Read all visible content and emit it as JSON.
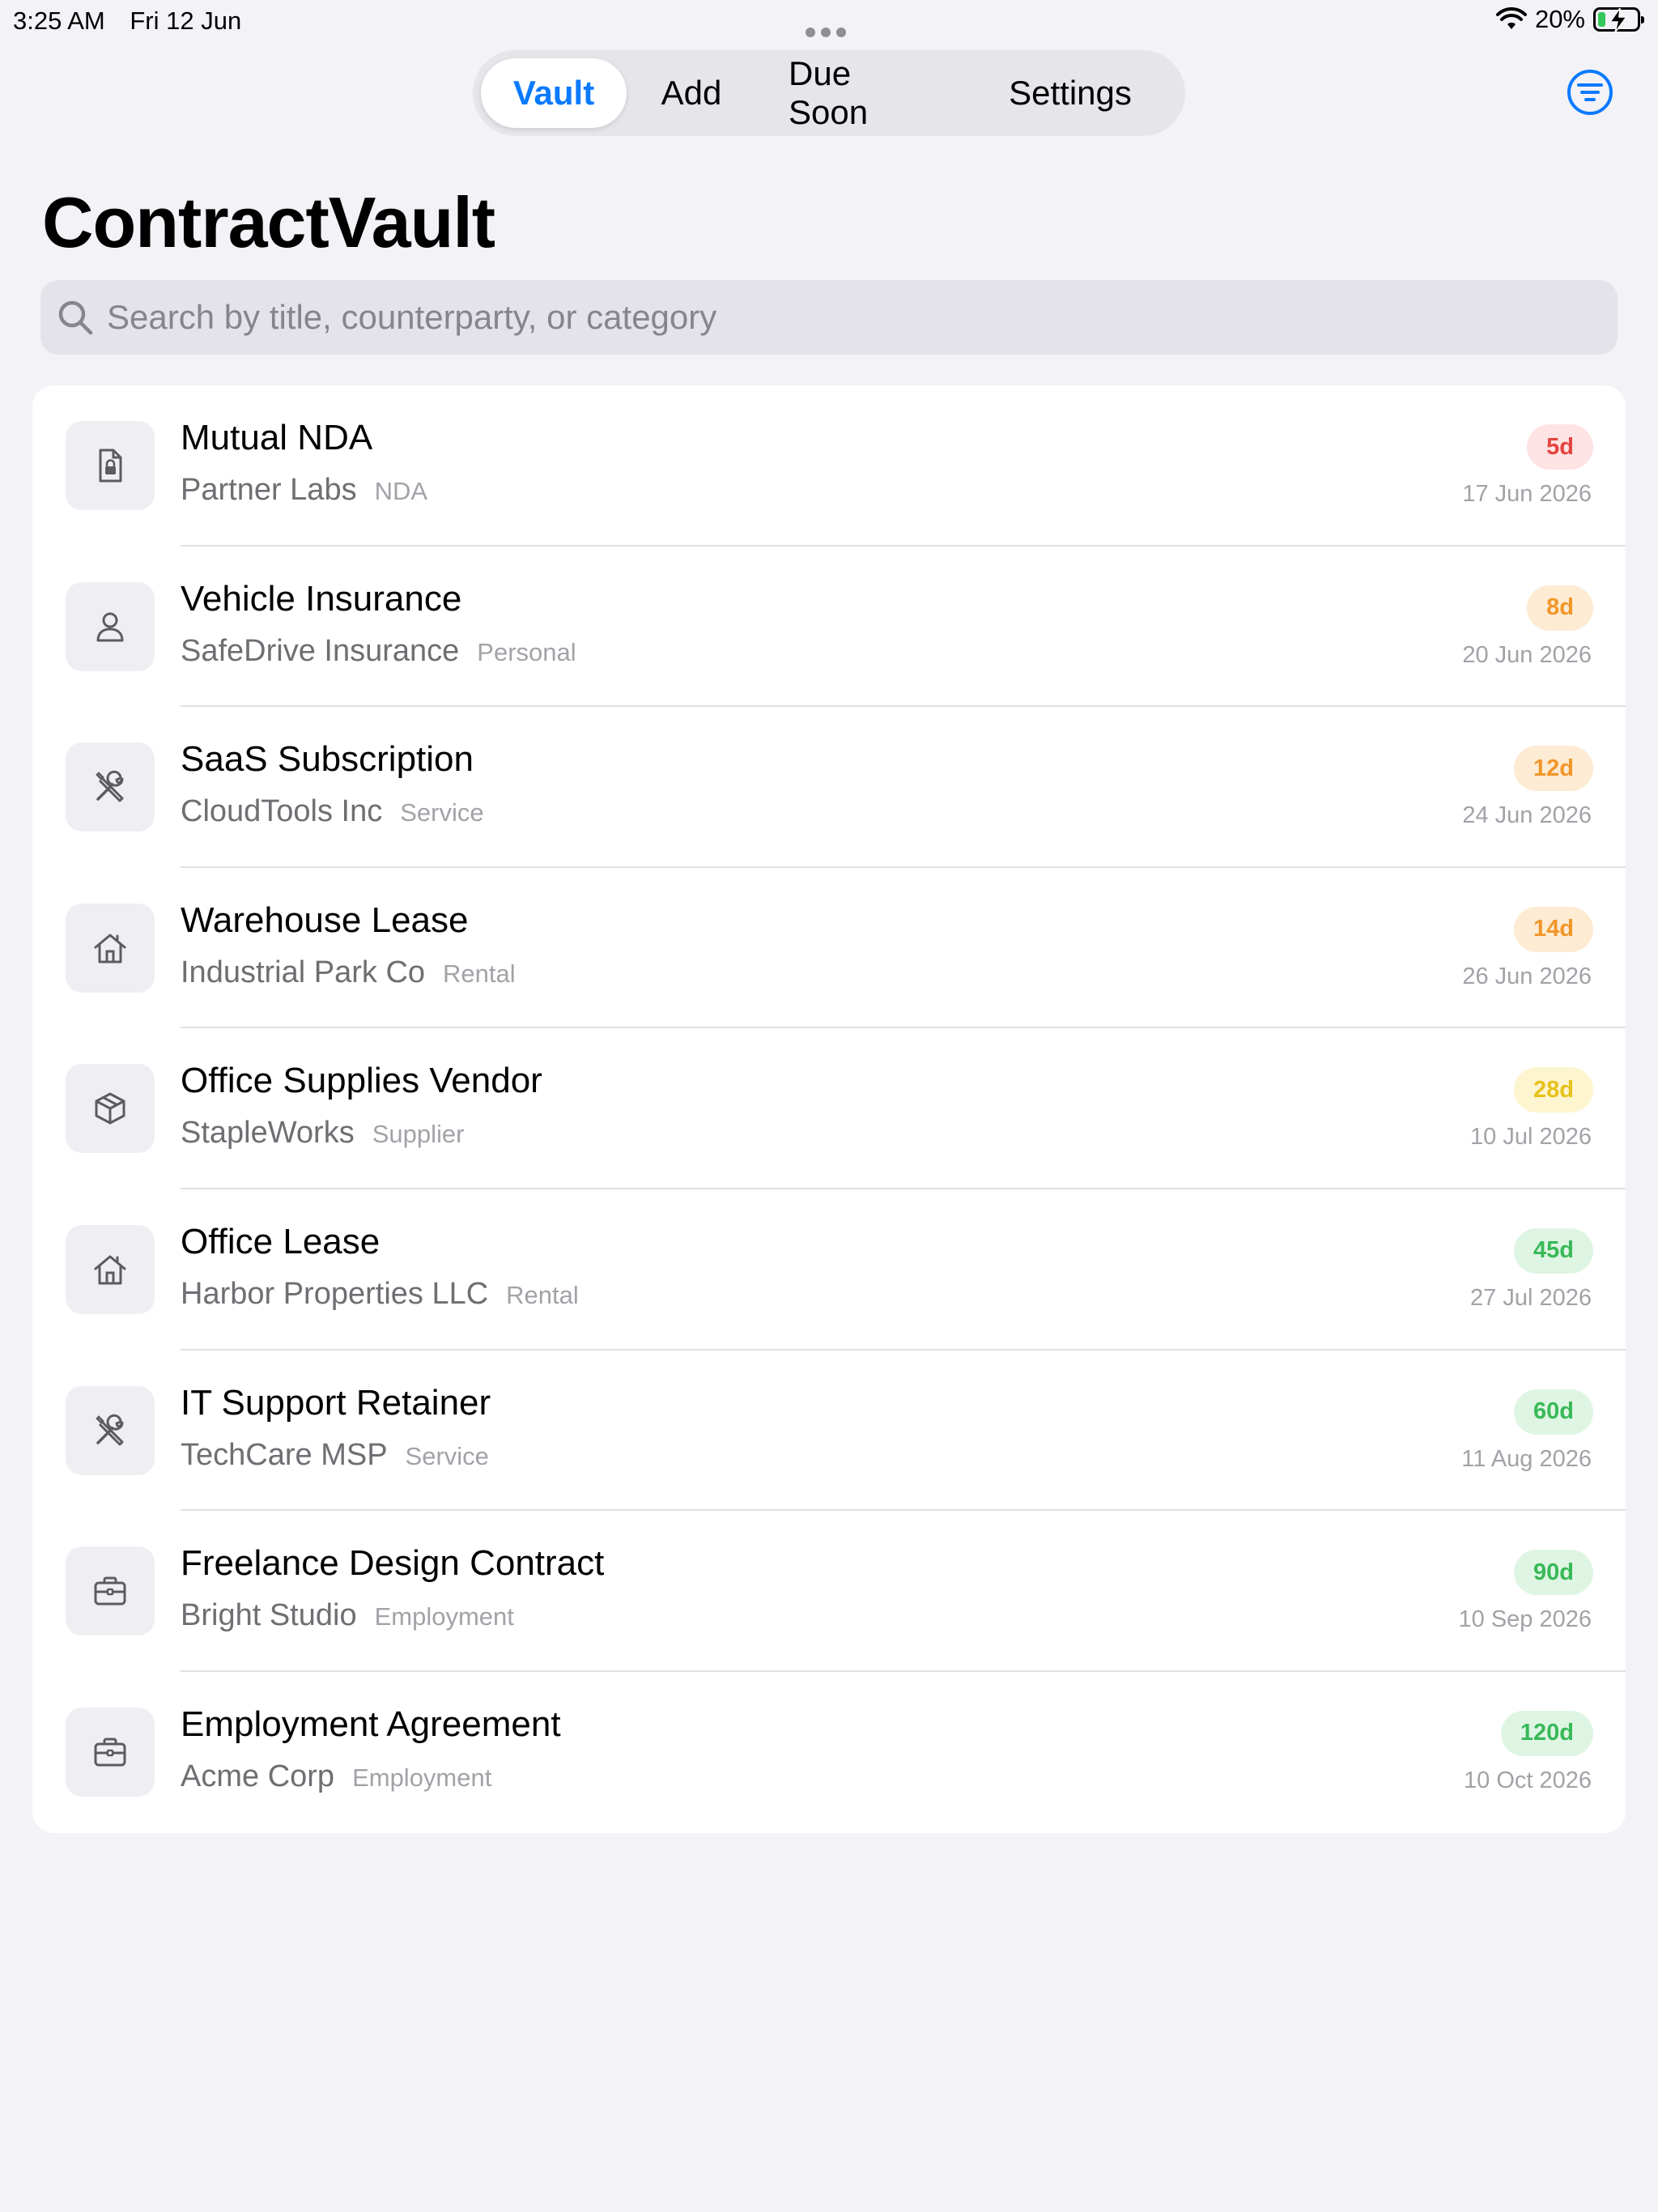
{
  "status_bar": {
    "time": "3:25 AM",
    "date": "Fri 12 Jun",
    "battery": "20%",
    "battery_level": 0.2
  },
  "nav": {
    "tabs": [
      {
        "label": "Vault",
        "active": true
      },
      {
        "label": "Add",
        "active": false
      },
      {
        "label": "Due Soon",
        "active": false
      },
      {
        "label": "Settings",
        "active": false
      }
    ],
    "filter_icon": "filter-circle-icon"
  },
  "page": {
    "title": "ContractVault"
  },
  "search": {
    "placeholder": "Search by title, counterparty, or category",
    "value": ""
  },
  "colors": {
    "accent": "#0a7aff",
    "red": "#e5433f",
    "orange": "#f2962a",
    "yellow": "#e7c21b",
    "green": "#38b958"
  },
  "contracts": [
    {
      "title": "Mutual NDA",
      "counterparty": "Partner Labs",
      "category": "NDA",
      "days": "5d",
      "date": "17 Jun 2026",
      "tone": "red",
      "icon": "doc-lock-icon"
    },
    {
      "title": "Vehicle Insurance",
      "counterparty": "SafeDrive Insurance",
      "category": "Personal",
      "days": "8d",
      "date": "20 Jun 2026",
      "tone": "orange",
      "icon": "person-icon"
    },
    {
      "title": "SaaS Subscription",
      "counterparty": "CloudTools Inc",
      "category": "Service",
      "days": "12d",
      "date": "24 Jun 2026",
      "tone": "orange",
      "icon": "tools-icon"
    },
    {
      "title": "Warehouse Lease",
      "counterparty": "Industrial Park Co",
      "category": "Rental",
      "days": "14d",
      "date": "26 Jun 2026",
      "tone": "orange",
      "icon": "house-icon"
    },
    {
      "title": "Office Supplies Vendor",
      "counterparty": "StapleWorks",
      "category": "Supplier",
      "days": "28d",
      "date": "10 Jul 2026",
      "tone": "yellow",
      "icon": "box-icon"
    },
    {
      "title": "Office Lease",
      "counterparty": "Harbor Properties LLC",
      "category": "Rental",
      "days": "45d",
      "date": "27 Jul 2026",
      "tone": "green",
      "icon": "house-icon"
    },
    {
      "title": "IT Support Retainer",
      "counterparty": "TechCare MSP",
      "category": "Service",
      "days": "60d",
      "date": "11 Aug 2026",
      "tone": "green",
      "icon": "tools-icon"
    },
    {
      "title": "Freelance Design Contract",
      "counterparty": "Bright Studio",
      "category": "Employment",
      "days": "90d",
      "date": "10 Sep 2026",
      "tone": "green",
      "icon": "briefcase-icon"
    },
    {
      "title": "Employment Agreement",
      "counterparty": "Acme Corp",
      "category": "Employment",
      "days": "120d",
      "date": "10 Oct 2026",
      "tone": "green",
      "icon": "briefcase-icon"
    }
  ]
}
